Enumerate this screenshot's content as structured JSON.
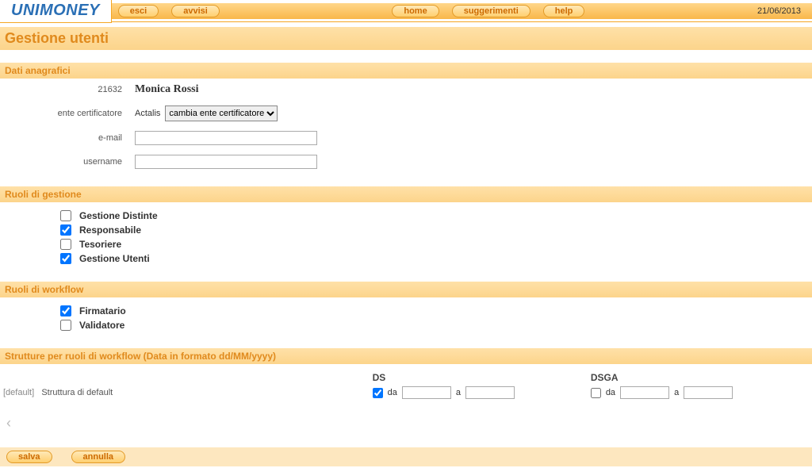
{
  "brand": "UNIMONEY",
  "nav": {
    "esci": "esci",
    "avvisi": "avvisi",
    "home": "home",
    "suggerimenti": "suggerimenti",
    "help": "help",
    "date": "21/06/2013"
  },
  "page_title": "Gestione utenti",
  "sections": {
    "anagrafica": "Dati anagrafici",
    "ruoli_gestione": "Ruoli di gestione",
    "ruoli_workflow": "Ruoli di workflow",
    "strutture": "Strutture per ruoli di workflow (Data in formato dd/MM/yyyy)"
  },
  "form": {
    "id_label": "21632",
    "full_name": "Monica Rossi",
    "ente_label": "ente certificatore",
    "ente_value": "Actalis",
    "ente_select_placeholder": "cambia ente certificatore",
    "email_label": "e-mail",
    "email_value": "",
    "username_label": "username",
    "username_value": ""
  },
  "ruoli_gestione": [
    {
      "label": "Gestione Distinte",
      "checked": false
    },
    {
      "label": "Responsabile",
      "checked": true
    },
    {
      "label": "Tesoriere",
      "checked": false
    },
    {
      "label": "Gestione Utenti",
      "checked": true
    }
  ],
  "ruoli_workflow": [
    {
      "label": "Firmatario",
      "checked": true
    },
    {
      "label": "Validatore",
      "checked": false
    }
  ],
  "strutture": {
    "col_ds": "DS",
    "col_dsga": "DSGA",
    "da": "da",
    "a": "a",
    "default_tag": "[default]",
    "default_name": "Struttura di default",
    "row": {
      "ds_checked": true,
      "ds_da": "",
      "ds_a": "",
      "dsga_checked": false,
      "dsga_da": "",
      "dsga_a": ""
    }
  },
  "buttons": {
    "salva": "salva",
    "annulla": "annulla"
  }
}
